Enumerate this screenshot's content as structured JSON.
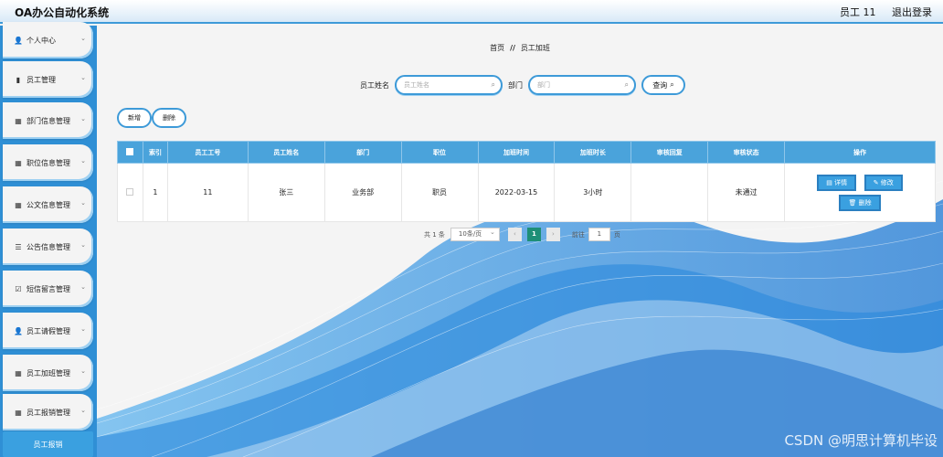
{
  "header": {
    "title": "OA办公自动化系统",
    "user": "员工 11",
    "logout": "退出登录"
  },
  "sidebar": {
    "items": [
      {
        "label": "个人中心",
        "icon": "user-icon"
      },
      {
        "label": "员工管理",
        "icon": "clipboard-icon"
      },
      {
        "label": "部门信息管理",
        "icon": "grid-icon"
      },
      {
        "label": "职位信息管理",
        "icon": "grid-icon"
      },
      {
        "label": "公文信息管理",
        "icon": "grid-icon"
      },
      {
        "label": "公告信息管理",
        "icon": "list-icon"
      },
      {
        "label": "短信留言管理",
        "icon": "checkbox-icon"
      },
      {
        "label": "员工请假管理",
        "icon": "user-icon"
      },
      {
        "label": "员工加班管理",
        "icon": "grid-icon"
      },
      {
        "label": "员工报销管理",
        "icon": "grid-icon"
      }
    ],
    "submenu_label": "员工报销"
  },
  "breadcrumb": {
    "home": "首页",
    "separator": "//",
    "current": "员工加班"
  },
  "search": {
    "name_label": "员工姓名",
    "name_placeholder": "员工姓名",
    "dept_label": "部门",
    "dept_placeholder": "部门",
    "query_button": "查询"
  },
  "actions": {
    "add": "新增",
    "delete": "删除"
  },
  "table": {
    "columns": [
      "索引",
      "员工工号",
      "员工姓名",
      "部门",
      "职位",
      "加班时间",
      "加班时长",
      "审核回复",
      "审核状态",
      "操作"
    ],
    "rows": [
      {
        "index": "1",
        "emp_no": "11",
        "name": "张三",
        "dept": "业务部",
        "position": "职员",
        "date": "2022-03-15",
        "duration": "3小时",
        "reply": "",
        "status": "未通过"
      }
    ],
    "row_buttons": {
      "detail": "详情",
      "edit": "修改",
      "delete": "删除"
    }
  },
  "pagination": {
    "total": "共 1 条",
    "page_size": "10条/页",
    "current_page": "1",
    "goto_label": "前往",
    "goto_value": "1",
    "page_suffix": "页"
  },
  "watermark": "CSDN @明思计算机毕设",
  "colors": {
    "accent": "#3d9ad8",
    "table_header": "#4aa3db",
    "page_active": "#1e8f77"
  }
}
